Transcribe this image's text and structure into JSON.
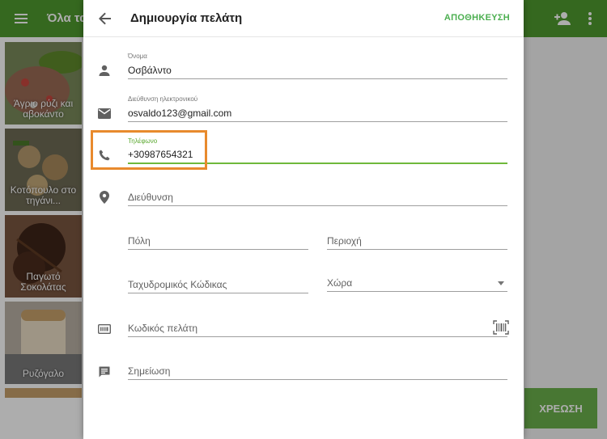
{
  "background": {
    "title": "Όλα τα",
    "tiles": [
      {
        "label": "Άγριο ρύζι και αβοκάντο"
      },
      {
        "label": "Κοτόπουλο στο τηγάνι..."
      },
      {
        "label": "Παγωτό Σοκολάτας"
      },
      {
        "label": "Ρυζόγαλο"
      }
    ],
    "charge_label": "ΧΡΕΩΣΗ"
  },
  "dialog": {
    "title": "Δημιουργία πελάτη",
    "save_label": "ΑΠΟΘΗΚΕΥΣΗ",
    "fields": {
      "name": {
        "label": "Όνομα",
        "value": "Οσβάλντο"
      },
      "email": {
        "label": "Διεύθυνση ηλεκτρονικού",
        "value": "osvaldo123@gmail.com"
      },
      "phone": {
        "label": "Τηλέφωνο",
        "value": "+30987654321"
      },
      "address": {
        "placeholder": "Διεύθυνση"
      },
      "city": {
        "placeholder": "Πόλη"
      },
      "region": {
        "placeholder": "Περιοχή"
      },
      "postal_code": {
        "placeholder": "Ταχυδρομικός Κώδικας"
      },
      "country": {
        "placeholder": "Χώρα"
      },
      "customer_code": {
        "placeholder": "Κωδικός πελάτη"
      },
      "note": {
        "placeholder": "Σημείωση"
      }
    }
  },
  "colors": {
    "accent": "#6fb83b",
    "highlight": "#e88a2d",
    "app_bar": "#4e9a2e"
  },
  "icons": [
    "menu-icon",
    "add-person-icon",
    "more-vert-icon",
    "back-arrow-icon",
    "person-icon",
    "email-icon",
    "phone-icon",
    "location-pin-icon",
    "customer-card-icon",
    "note-icon",
    "barcode-icon"
  ]
}
